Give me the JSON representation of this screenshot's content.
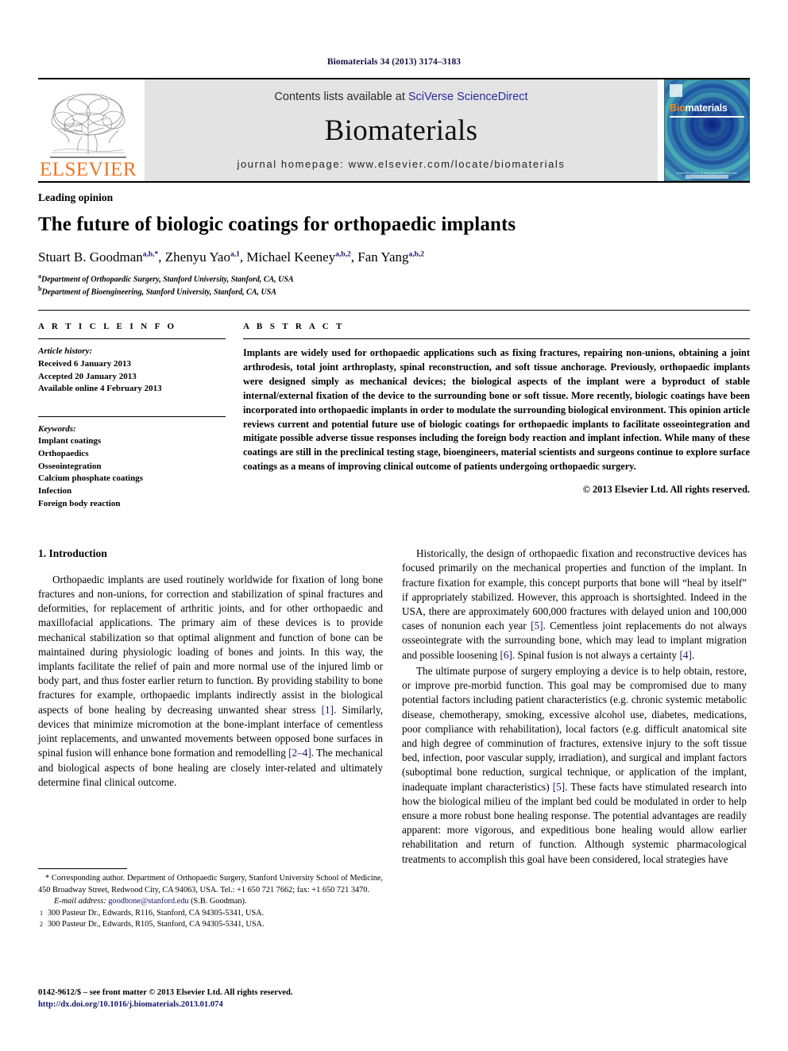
{
  "running_head": "Biomaterials 34 (2013) 3174–3183",
  "masthead": {
    "publisher_name": "ELSEVIER",
    "contents_prefix": "Contents lists available at ",
    "contents_link": "SciVerse ScienceDirect",
    "journal_title": "Biomaterials",
    "homepage": "journal homepage: www.elsevier.com/locate/biomaterials",
    "cover": {
      "title_part1": "Bio",
      "title_part2": "materials",
      "footer_text": "available online at www.sciencedirect.com"
    }
  },
  "article": {
    "section_label": "Leading opinion",
    "title": "The future of biologic coatings for orthopaedic implants",
    "authors": [
      {
        "name": "Stuart B. Goodman",
        "marks": "a,b,*"
      },
      {
        "name": "Zhenyu Yao",
        "marks": "a,1"
      },
      {
        "name": "Michael Keeney",
        "marks": "a,b,2"
      },
      {
        "name": "Fan Yang",
        "marks": "a,b,2"
      }
    ],
    "affiliations": [
      {
        "mark": "a",
        "text": "Department of Orthopaedic Surgery, Stanford University, Stanford, CA, USA"
      },
      {
        "mark": "b",
        "text": "Department of Bioengineering, Stanford University, Stanford, CA, USA"
      }
    ]
  },
  "article_info": {
    "heading": "A R T I C L E   I N F O",
    "history_label": "Article history:",
    "history": [
      "Received 6 January 2013",
      "Accepted 20 January 2013",
      "Available online 4 February 2013"
    ],
    "keywords_label": "Keywords:",
    "keywords": [
      "Implant coatings",
      "Orthopaedics",
      "Osseointegration",
      "Calcium phosphate coatings",
      "Infection",
      "Foreign body reaction"
    ]
  },
  "abstract": {
    "heading": "A B S T R A C T",
    "text": "Implants are widely used for orthopaedic applications such as fixing fractures, repairing non-unions, obtaining a joint arthrodesis, total joint arthroplasty, spinal reconstruction, and soft tissue anchorage. Previously, orthopaedic implants were designed simply as mechanical devices; the biological aspects of the implant were a byproduct of stable internal/external fixation of the device to the surrounding bone or soft tissue. More recently, biologic coatings have been incorporated into orthopaedic implants in order to modulate the surrounding biological environment. This opinion article reviews current and potential future use of biologic coatings for orthopaedic implants to facilitate osseointegration and mitigate possible adverse tissue responses including the foreign body reaction and implant infection. While many of these coatings are still in the preclinical testing stage, bioengineers, material scientists and surgeons continue to explore surface coatings as a means of improving clinical outcome of patients undergoing orthopaedic surgery.",
    "copyright": "© 2013 Elsevier Ltd. All rights reserved."
  },
  "body": {
    "section_number_title": "1. Introduction",
    "left_paragraphs": [
      "Orthopaedic implants are used routinely worldwide for fixation of long bone fractures and non-unions, for correction and stabilization of spinal fractures and deformities, for replacement of arthritic joints, and for other orthopaedic and maxillofacial applications. The primary aim of these devices is to provide mechanical stabilization so that optimal alignment and function of bone can be maintained during physiologic loading of bones and joints. In this way, the implants facilitate the relief of pain and more normal use of the injured limb or body part, and thus foster earlier return to function. By providing stability to bone fractures for example, orthopaedic implants indirectly assist in the biological aspects of bone healing by decreasing unwanted shear stress [1]. Similarly, devices that minimize micromotion at the bone-implant interface of cementless joint replacements, and unwanted movements between opposed bone surfaces in spinal fusion will enhance bone formation and remodelling [2–4]. The mechanical and biological aspects of bone healing are closely inter-related and ultimately determine final clinical outcome."
    ],
    "right_paragraphs": [
      "Historically, the design of orthopaedic fixation and reconstructive devices has focused primarily on the mechanical properties and function of the implant. In fracture fixation for example, this concept purports that bone will “heal by itself” if appropriately stabilized. However, this approach is shortsighted. Indeed in the USA, there are approximately 600,000 fractures with delayed union and 100,000 cases of nonunion each year [5]. Cementless joint replacements do not always osseointegrate with the surrounding bone, which may lead to implant migration and possible loosening [6]. Spinal fusion is not always a certainty [4].",
      "The ultimate purpose of surgery employing a device is to help obtain, restore, or improve pre-morbid function. This goal may be compromised due to many potential factors including patient characteristics (e.g. chronic systemic metabolic disease, chemotherapy, smoking, excessive alcohol use, diabetes, medications, poor compliance with rehabilitation), local factors (e.g. difficult anatomical site and high degree of comminution of fractures, extensive injury to the soft tissue bed, infection, poor vascular supply, irradiation), and surgical and implant factors (suboptimal bone reduction, surgical technique, or application of the implant, inadequate implant characteristics) [5]. These facts have stimulated research into how the biological milieu of the implant bed could be modulated in order to help ensure a more robust bone healing response. The potential advantages are readily apparent: more vigorous, and expeditious bone healing would allow earlier rehabilitation and return of function. Although systemic pharmacological treatments to accomplish this goal have been considered, local strategies have"
    ]
  },
  "footnotes": {
    "corresponding": "* Corresponding author. Department of Orthopaedic Surgery, Stanford University School of Medicine, 450 Broadway Street, Redwood City, CA 94063, USA. Tel.: +1 650 721 7662; fax: +1 650 721 3470.",
    "email_label": "E-mail address:",
    "email": "goodbone@stanford.edu",
    "email_owner": "(S.B. Goodman).",
    "note1_mark": "1",
    "note1": "300 Pasteur Dr., Edwards, R116, Stanford, CA 94305-5341, USA.",
    "note2_mark": "2",
    "note2": "300 Pasteur Dr., Edwards, R105, Stanford, CA 94305-5341, USA."
  },
  "imprint": {
    "issn_line": "0142-9612/$ – see front matter © 2013 Elsevier Ltd. All rights reserved.",
    "doi": "http://dx.doi.org/10.1016/j.biomaterials.2013.01.074"
  },
  "colors": {
    "link_blue": "#16166b",
    "sciencedirect_blue": "#2b2b9e",
    "elsevier_orange": "#E87722",
    "banner_gray": "#e3e3e3"
  }
}
